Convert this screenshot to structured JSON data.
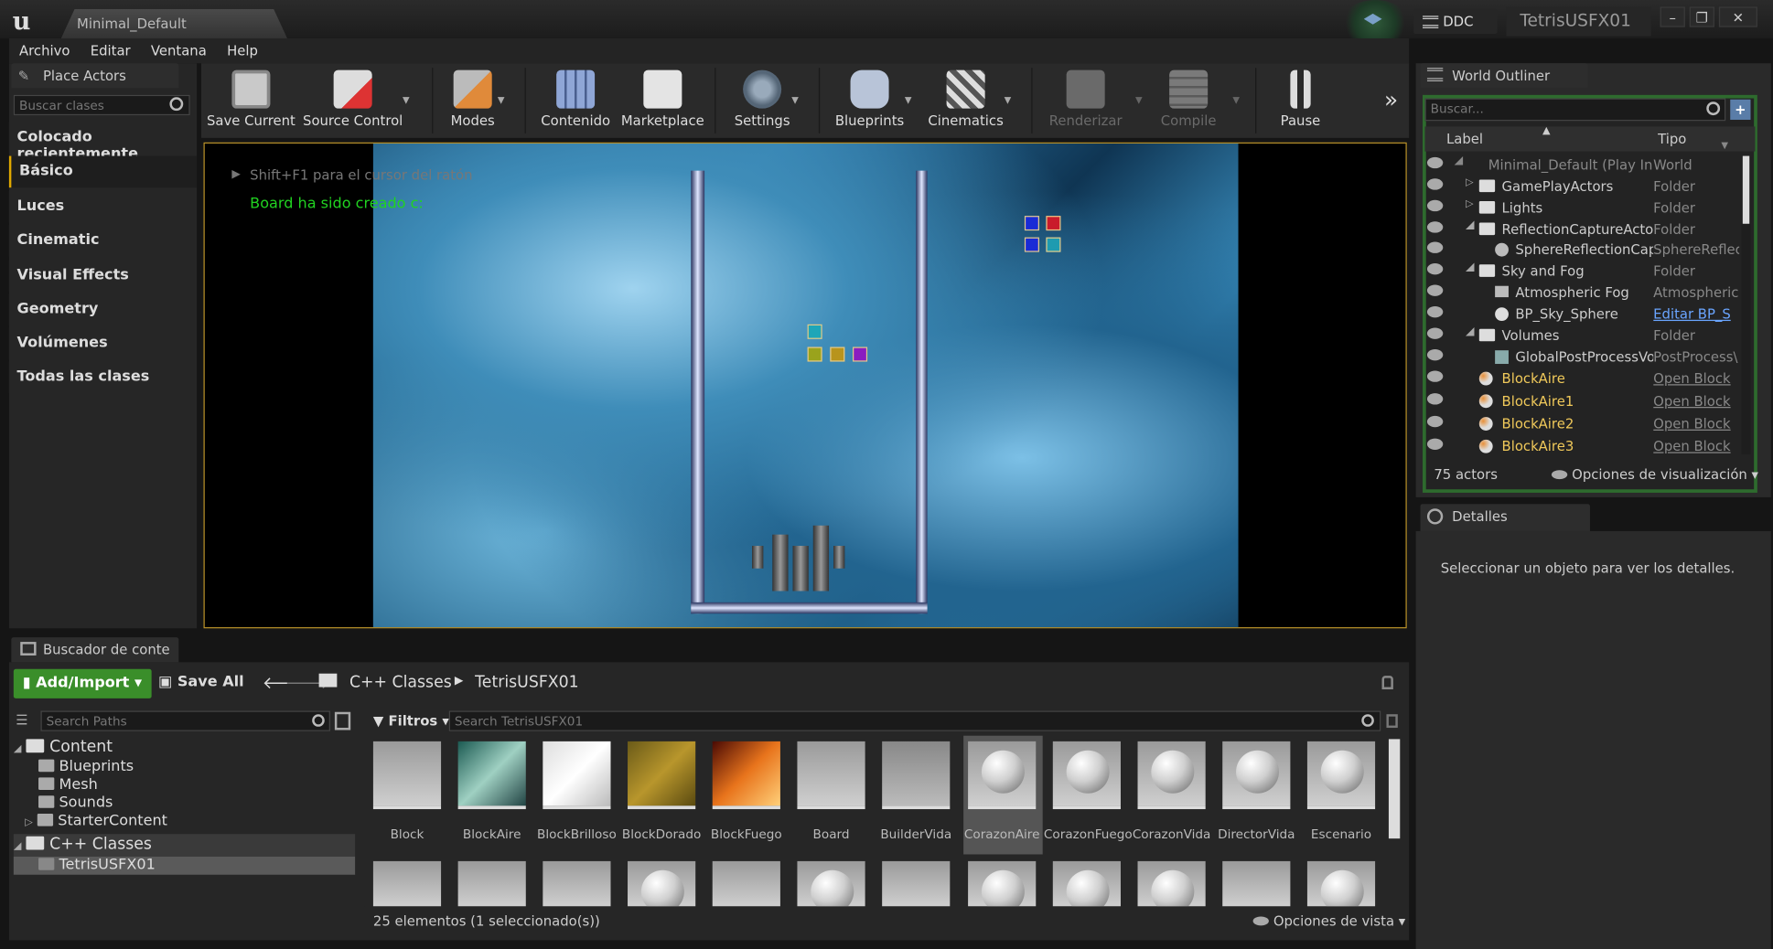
{
  "window": {
    "doc_tab": "Minimal_Default",
    "ddc_label": "DDC",
    "project_name": "TetrisUSFX01"
  },
  "menu": [
    "Archivo",
    "Editar",
    "Ventana",
    "Help"
  ],
  "place_actors": {
    "tab": "Place Actors",
    "search_placeholder": "Buscar clases",
    "categories": [
      "Colocado recientemente",
      "Básico",
      "Luces",
      "Cinematic",
      "Visual Effects",
      "Geometry",
      "Volúmenes",
      "Todas las clases"
    ]
  },
  "toolbar": {
    "items": [
      "Save Current",
      "Source Control",
      "Modes",
      "Contenido",
      "Marketplace",
      "Settings",
      "Blueprints",
      "Cinematics",
      "Renderizar",
      "Compile",
      "Pause"
    ]
  },
  "viewport": {
    "hint": "Shift+F1 para el cursor del ratón",
    "log": "Board ha sido creado c:"
  },
  "outliner": {
    "tab": "World Outliner",
    "search_placeholder": "Buscar...",
    "col_label": "Label",
    "col_type": "Tipo",
    "rows": [
      {
        "label": "Minimal_Default (Play In E",
        "type": "World"
      },
      {
        "label": "GamePlayActors",
        "type": "Folder"
      },
      {
        "label": "Lights",
        "type": "Folder"
      },
      {
        "label": "ReflectionCaptureActors",
        "type": "Folder"
      },
      {
        "label": "SphereReflectionCapt",
        "type": "SphereReflec"
      },
      {
        "label": "Sky and Fog",
        "type": "Folder"
      },
      {
        "label": "Atmospheric Fog",
        "type": "AtmosphericF"
      },
      {
        "label": "BP_Sky_Sphere",
        "type": "Editar BP_S"
      },
      {
        "label": "Volumes",
        "type": "Folder"
      },
      {
        "label": "GlobalPostProcessVo",
        "type": "PostProcess\\"
      },
      {
        "label": "BlockAire",
        "type": "Open Block"
      },
      {
        "label": "BlockAire1",
        "type": "Open Block"
      },
      {
        "label": "BlockAire2",
        "type": "Open Block"
      },
      {
        "label": "BlockAire3",
        "type": "Open Block"
      }
    ],
    "actor_count": "75 actors",
    "view_options": "Opciones de visualización"
  },
  "details": {
    "tab": "Detalles",
    "empty_message": "Seleccionar un objeto para ver los detalles."
  },
  "content_browser": {
    "tab": "Buscador de conte",
    "add_import": "Add/Import",
    "save_all": "Save All",
    "path": [
      "C++ Classes",
      "TetrisUSFX01"
    ],
    "search_paths_placeholder": "Search Paths",
    "filters": "Filtros",
    "search_placeholder": "Search TetrisUSFX01",
    "tree": [
      "Content",
      "Blueprints",
      "Mesh",
      "Sounds",
      "StarterContent",
      "C++ Classes",
      "TetrisUSFX01"
    ],
    "assets": [
      "Block",
      "BlockAire",
      "BlockBrilloso",
      "BlockDorado",
      "BlockFuego",
      "Board",
      "BuilderVida",
      "CorazonAire",
      "CorazonFuego",
      "CorazonVida",
      "DirectorVida",
      "Escenario"
    ],
    "status": "25 elementos (1 seleccionado(s))",
    "view_options": "Opciones de vista"
  }
}
